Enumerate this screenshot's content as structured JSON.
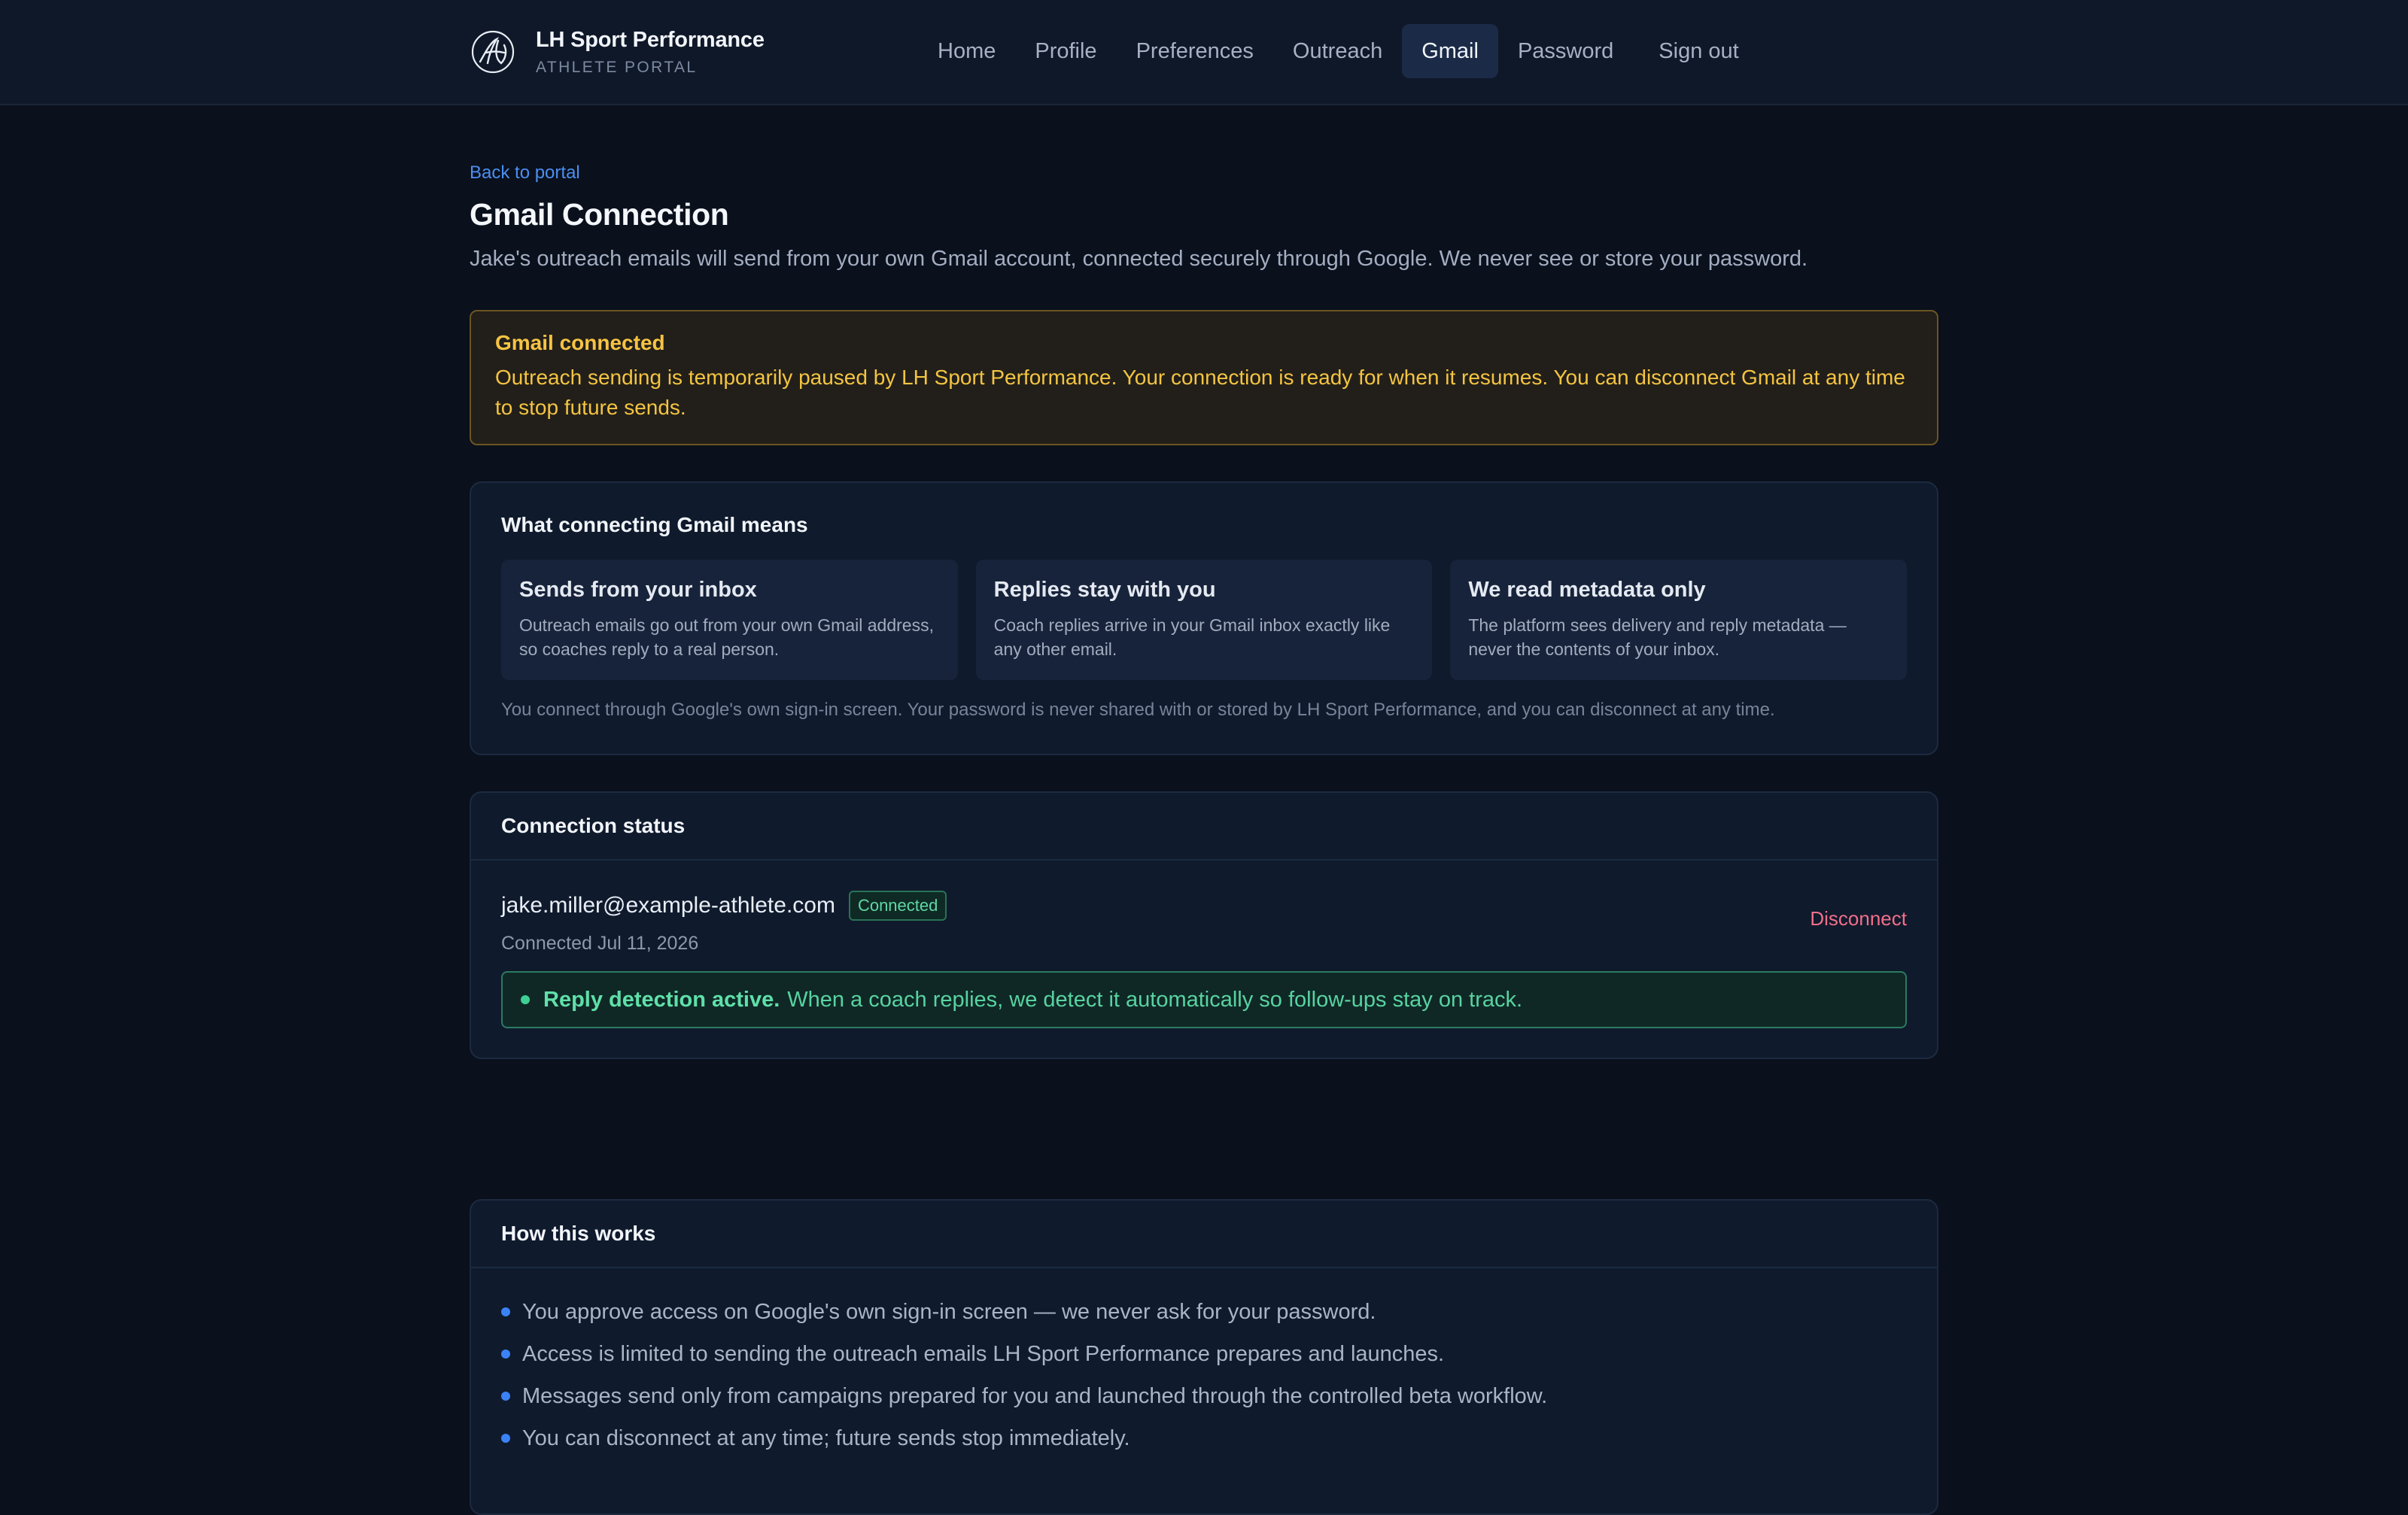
{
  "header": {
    "brand_name": "LH Sport Performance",
    "brand_subtitle": "ATHLETE PORTAL",
    "nav": [
      {
        "label": "Home",
        "active": false
      },
      {
        "label": "Profile",
        "active": false
      },
      {
        "label": "Preferences",
        "active": false
      },
      {
        "label": "Outreach",
        "active": false
      },
      {
        "label": "Gmail",
        "active": true
      },
      {
        "label": "Password",
        "active": false
      },
      {
        "label": "Sign out",
        "active": false
      }
    ]
  },
  "page": {
    "back_link": "Back to portal",
    "title": "Gmail Connection",
    "description": "Jake's outreach emails will send from your own Gmail account, connected securely through Google. We never see or store your password."
  },
  "alert": {
    "title": "Gmail connected",
    "body": "Outreach sending is temporarily paused by LH Sport Performance. Your connection is ready for when it resumes. You can disconnect Gmail at any time to stop future sends."
  },
  "means": {
    "title": "What connecting Gmail means",
    "features": [
      {
        "title": "Sends from your inbox",
        "body": "Outreach emails go out from your own Gmail address, so coaches reply to a real person."
      },
      {
        "title": "Replies stay with you",
        "body": "Coach replies arrive in your Gmail inbox exactly like any other email."
      },
      {
        "title": "We read metadata only",
        "body": "The platform sees delivery and reply metadata — never the contents of your inbox."
      }
    ],
    "note": "You connect through Google's own sign-in screen. Your password is never shared with or stored by LH Sport Performance, and you can disconnect at any time."
  },
  "status": {
    "title": "Connection status",
    "email": "jake.miller@example-athlete.com",
    "badge": "Connected",
    "connected_date": "Connected Jul 11, 2026",
    "disconnect_label": "Disconnect",
    "reply_strong": "Reply detection active.",
    "reply_text": "When a coach replies, we detect it automatically so follow-ups stay on track."
  },
  "how": {
    "title": "How this works",
    "items": [
      "You approve access on Google's own sign-in screen — we never ask for your password.",
      "Access is limited to sending the outreach emails LH Sport Performance prepares and launches.",
      "Messages send only from campaigns prepared for you and launched through the controlled beta workflow.",
      "You can disconnect at any time; future sends stop immediately."
    ]
  },
  "colors": {
    "background": "#0a101c",
    "accent": "#4b8ff0",
    "warning": "#f6c343",
    "success": "#5fe0a9",
    "danger": "#f26f8a"
  }
}
